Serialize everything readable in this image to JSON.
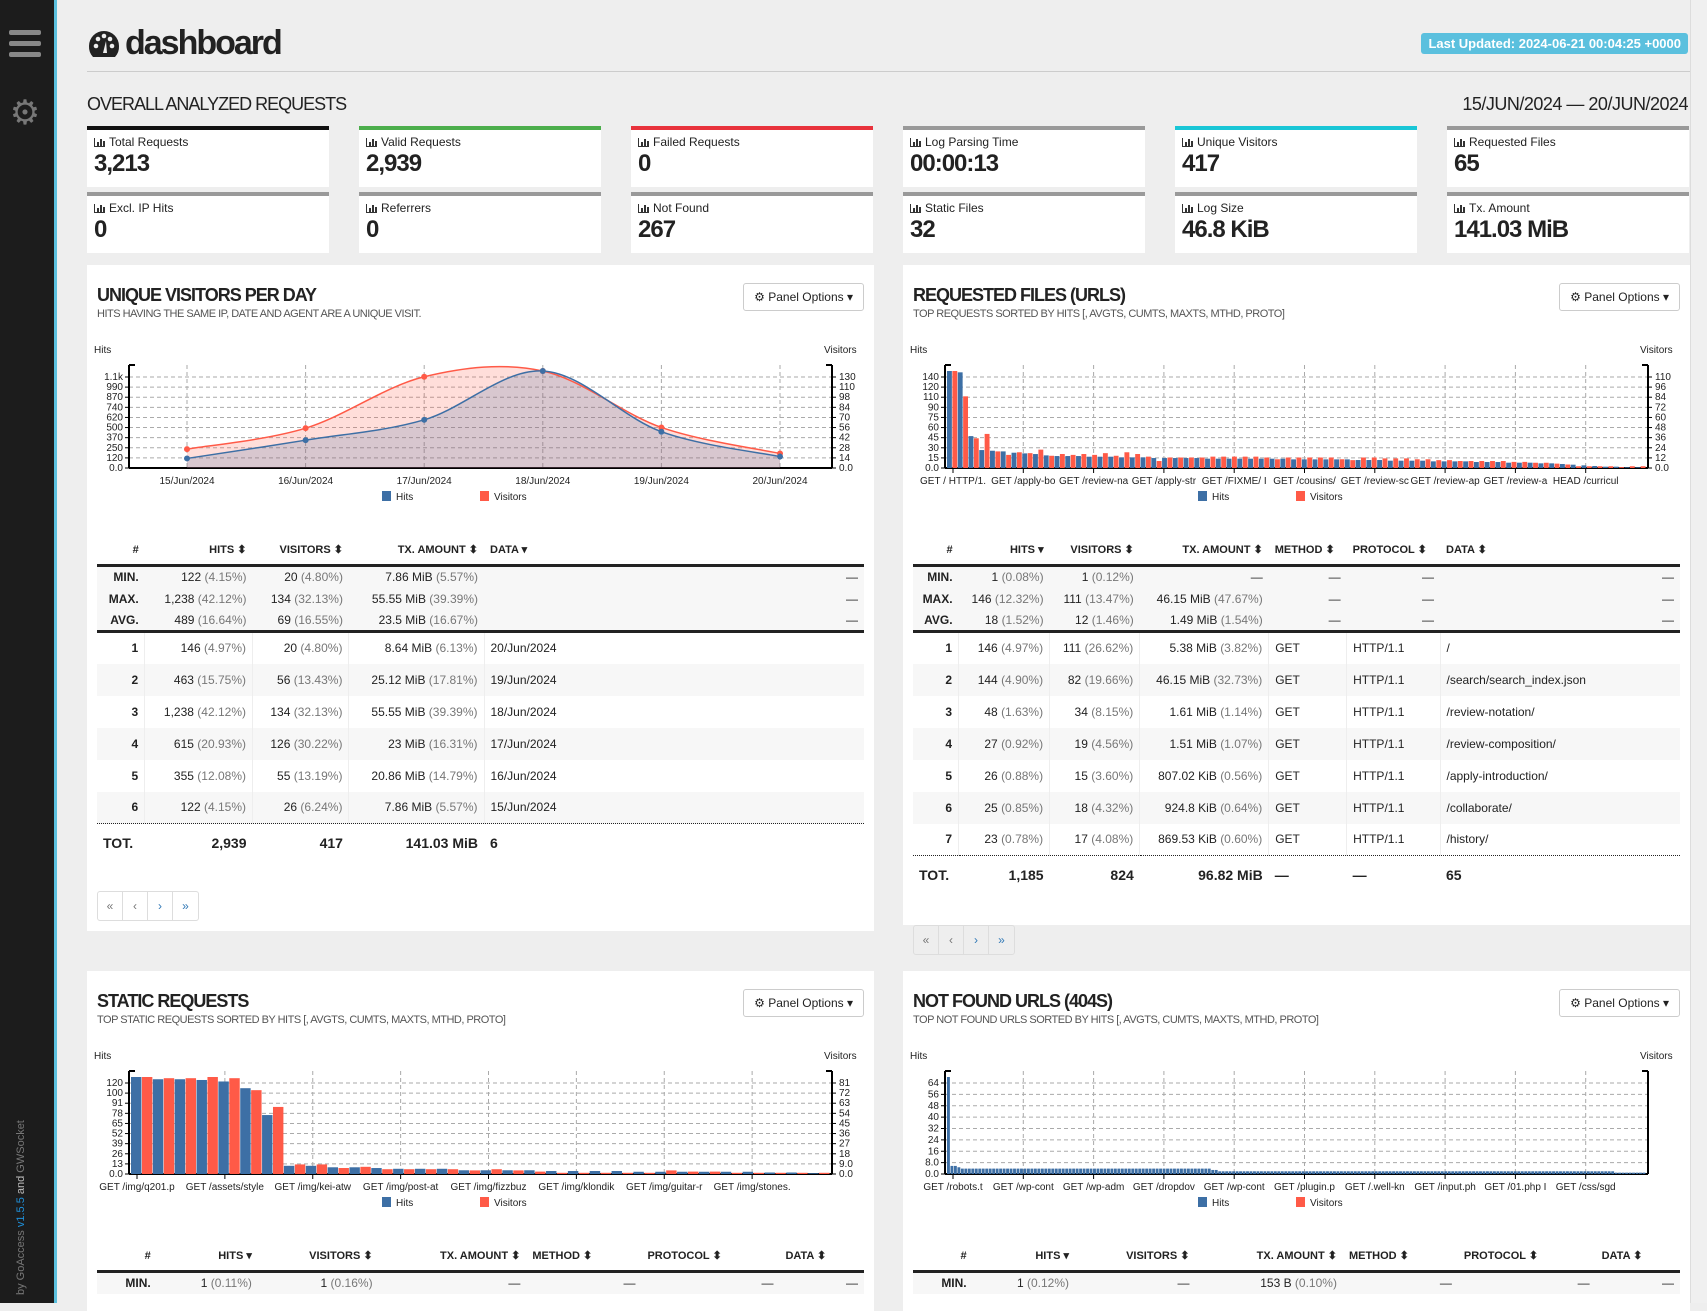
{
  "sidebar": {
    "credit_prefix": "by GoAccess ",
    "version": "v1.5.5",
    "credit_and": " and ",
    "credit_suffix": "GWSocket"
  },
  "header": {
    "title": "dashboard",
    "last_updated": "Last Updated: 2024-06-21 00:04:25 +0000"
  },
  "overall": {
    "title": "OVERALL ANALYZED REQUESTS",
    "date_range": "15/JUN/2024 — 20/JUN/2024",
    "kpis": [
      {
        "label": "Total Requests",
        "value": "3,213",
        "color": "#111111"
      },
      {
        "label": "Valid Requests",
        "value": "2,939",
        "color": "#4cae4c"
      },
      {
        "label": "Failed Requests",
        "value": "0",
        "color": "#e8323c"
      },
      {
        "label": "Log Parsing Time",
        "value": "00:00:13",
        "color": "#999999"
      },
      {
        "label": "Unique Visitors",
        "value": "417",
        "color": "#19c6d6"
      },
      {
        "label": "Requested Files",
        "value": "65",
        "color": "#999999"
      },
      {
        "label": "Excl. IP Hits",
        "value": "0",
        "color": "#999999"
      },
      {
        "label": "Referrers",
        "value": "0",
        "color": "#999999"
      },
      {
        "label": "Not Found",
        "value": "267",
        "color": "#999999"
      },
      {
        "label": "Static Files",
        "value": "32",
        "color": "#999999"
      },
      {
        "label": "Log Size",
        "value": "46.8 KiB",
        "color": "#999999"
      },
      {
        "label": "Tx. Amount",
        "value": "141.03 MiB",
        "color": "#999999"
      }
    ]
  },
  "colors": {
    "hits": "#3d6fa5",
    "visitors": "#ff5a47",
    "accent": "#5bc0de"
  },
  "panel_options_label": "Panel Options",
  "legend": {
    "hits": "Hits",
    "visitors": "Visitors"
  },
  "pager": [
    "«",
    "‹",
    "›",
    "»"
  ],
  "visitors_panel": {
    "title": "UNIQUE VISITORS PER DAY",
    "subtitle": "HITS HAVING THE SAME IP, DATE AND AGENT ARE A UNIQUE VISIT.",
    "columns": [
      "#",
      "HITS ⬍",
      "VISITORS ⬍",
      "TX. AMOUNT ⬍",
      "DATA ▾"
    ],
    "stats": [
      {
        "label": "MIN.",
        "hits": "122",
        "hits_pct": "(4.15%)",
        "visitors": "20",
        "visitors_pct": "(4.80%)",
        "tx": "7.86 MiB",
        "tx_pct": "(5.57%)",
        "data": "—"
      },
      {
        "label": "MAX.",
        "hits": "1,238",
        "hits_pct": "(42.12%)",
        "visitors": "134",
        "visitors_pct": "(32.13%)",
        "tx": "55.55 MiB",
        "tx_pct": "(39.39%)",
        "data": "—"
      },
      {
        "label": "AVG.",
        "hits": "489",
        "hits_pct": "(16.64%)",
        "visitors": "69",
        "visitors_pct": "(16.55%)",
        "tx": "23.5 MiB",
        "tx_pct": "(16.67%)",
        "data": "—"
      }
    ],
    "rows": [
      {
        "n": "1",
        "hits": "146",
        "hits_pct": "(4.97%)",
        "visitors": "20",
        "visitors_pct": "(4.80%)",
        "tx": "8.64 MiB",
        "tx_pct": "(6.13%)",
        "data": "20/Jun/2024"
      },
      {
        "n": "2",
        "hits": "463",
        "hits_pct": "(15.75%)",
        "visitors": "56",
        "visitors_pct": "(13.43%)",
        "tx": "25.12 MiB",
        "tx_pct": "(17.81%)",
        "data": "19/Jun/2024"
      },
      {
        "n": "3",
        "hits": "1,238",
        "hits_pct": "(42.12%)",
        "visitors": "134",
        "visitors_pct": "(32.13%)",
        "tx": "55.55 MiB",
        "tx_pct": "(39.39%)",
        "data": "18/Jun/2024"
      },
      {
        "n": "4",
        "hits": "615",
        "hits_pct": "(20.93%)",
        "visitors": "126",
        "visitors_pct": "(30.22%)",
        "tx": "23 MiB",
        "tx_pct": "(16.31%)",
        "data": "17/Jun/2024"
      },
      {
        "n": "5",
        "hits": "355",
        "hits_pct": "(12.08%)",
        "visitors": "55",
        "visitors_pct": "(13.19%)",
        "tx": "20.86 MiB",
        "tx_pct": "(14.79%)",
        "data": "16/Jun/2024"
      },
      {
        "n": "6",
        "hits": "122",
        "hits_pct": "(4.15%)",
        "visitors": "26",
        "visitors_pct": "(6.24%)",
        "tx": "7.86 MiB",
        "tx_pct": "(5.57%)",
        "data": "15/Jun/2024"
      }
    ],
    "total": {
      "label": "TOT.",
      "hits": "2,939",
      "visitors": "417",
      "tx": "141.03 MiB",
      "data": "6"
    }
  },
  "files_panel": {
    "title": "REQUESTED FILES (URLS)",
    "subtitle": "TOP REQUESTS SORTED BY HITS [, AVGTS, CUMTS, MAXTS, MTHD, PROTO]",
    "columns": [
      "#",
      "HITS ▾",
      "VISITORS ⬍",
      "TX. AMOUNT ⬍",
      "METHOD ⬍",
      "PROTOCOL ⬍",
      "DATA ⬍"
    ],
    "stats": [
      {
        "label": "MIN.",
        "hits": "1",
        "hits_pct": "(0.08%)",
        "visitors": "1",
        "visitors_pct": "(0.12%)",
        "tx": "—",
        "tx_pct": "",
        "method": "—",
        "proto": "—",
        "data": "—"
      },
      {
        "label": "MAX.",
        "hits": "146",
        "hits_pct": "(12.32%)",
        "visitors": "111",
        "visitors_pct": "(13.47%)",
        "tx": "46.15 MiB",
        "tx_pct": "(47.67%)",
        "method": "—",
        "proto": "—",
        "data": "—"
      },
      {
        "label": "AVG.",
        "hits": "18",
        "hits_pct": "(1.52%)",
        "visitors": "12",
        "visitors_pct": "(1.46%)",
        "tx": "1.49 MiB",
        "tx_pct": "(1.54%)",
        "method": "—",
        "proto": "—",
        "data": "—"
      }
    ],
    "rows": [
      {
        "n": "1",
        "hits": "146",
        "hits_pct": "(4.97%)",
        "visitors": "111",
        "visitors_pct": "(26.62%)",
        "tx": "5.38 MiB",
        "tx_pct": "(3.82%)",
        "method": "GET",
        "proto": "HTTP/1.1",
        "data": "/"
      },
      {
        "n": "2",
        "hits": "144",
        "hits_pct": "(4.90%)",
        "visitors": "82",
        "visitors_pct": "(19.66%)",
        "tx": "46.15 MiB",
        "tx_pct": "(32.73%)",
        "method": "GET",
        "proto": "HTTP/1.1",
        "data": "/search/search_index.json"
      },
      {
        "n": "3",
        "hits": "48",
        "hits_pct": "(1.63%)",
        "visitors": "34",
        "visitors_pct": "(8.15%)",
        "tx": "1.61 MiB",
        "tx_pct": "(1.14%)",
        "method": "GET",
        "proto": "HTTP/1.1",
        "data": "/review-notation/"
      },
      {
        "n": "4",
        "hits": "27",
        "hits_pct": "(0.92%)",
        "visitors": "19",
        "visitors_pct": "(4.56%)",
        "tx": "1.51 MiB",
        "tx_pct": "(1.07%)",
        "method": "GET",
        "proto": "HTTP/1.1",
        "data": "/review-composition/"
      },
      {
        "n": "5",
        "hits": "26",
        "hits_pct": "(0.88%)",
        "visitors": "15",
        "visitors_pct": "(3.60%)",
        "tx": "807.02 KiB",
        "tx_pct": "(0.56%)",
        "method": "GET",
        "proto": "HTTP/1.1",
        "data": "/apply-introduction/"
      },
      {
        "n": "6",
        "hits": "25",
        "hits_pct": "(0.85%)",
        "visitors": "18",
        "visitors_pct": "(4.32%)",
        "tx": "924.8 KiB",
        "tx_pct": "(0.64%)",
        "method": "GET",
        "proto": "HTTP/1.1",
        "data": "/collaborate/"
      },
      {
        "n": "7",
        "hits": "23",
        "hits_pct": "(0.78%)",
        "visitors": "17",
        "visitors_pct": "(4.08%)",
        "tx": "869.53 KiB",
        "tx_pct": "(0.60%)",
        "method": "GET",
        "proto": "HTTP/1.1",
        "data": "/history/"
      }
    ],
    "total": {
      "label": "TOT.",
      "hits": "1,185",
      "visitors": "824",
      "tx": "96.82 MiB",
      "method": "—",
      "proto": "—",
      "data": "65"
    }
  },
  "static_panel": {
    "title": "STATIC REQUESTS",
    "subtitle": "TOP STATIC REQUESTS SORTED BY HITS [, AVGTS, CUMTS, MAXTS, MTHD, PROTO]",
    "columns": [
      "#",
      "HITS ▾",
      "VISITORS ⬍",
      "TX. AMOUNT ⬍",
      "METHOD ⬍",
      "PROTOCOL ⬍",
      "DATA ⬍"
    ],
    "stats": [
      {
        "label": "MIN.",
        "hits": "1",
        "hits_pct": "(0.11%)",
        "visitors": "1",
        "visitors_pct": "(0.16%)",
        "tx": "—",
        "tx_pct": "",
        "method": "—",
        "proto": "—",
        "data": "—"
      }
    ]
  },
  "notfound_panel": {
    "title": "NOT FOUND URLS (404S)",
    "subtitle": "TOP NOT FOUND URLS SORTED BY HITS [, AVGTS, CUMTS, MAXTS, MTHD, PROTO]",
    "columns": [
      "#",
      "HITS ▾",
      "VISITORS ⬍",
      "TX. AMOUNT ⬍",
      "METHOD ⬍",
      "PROTOCOL ⬍",
      "DATA ⬍"
    ],
    "stats": [
      {
        "label": "MIN.",
        "hits": "1",
        "hits_pct": "(0.12%)",
        "visitors": "—",
        "visitors_pct": "",
        "tx": "153 B",
        "tx_pct": "(0.10%)",
        "method": "—",
        "proto": "—",
        "data": "—"
      }
    ]
  },
  "chart_data": [
    {
      "type": "area",
      "title": "Unique Visitors Per Day",
      "x": [
        "15/Jun/2024",
        "16/Jun/2024",
        "17/Jun/2024",
        "18/Jun/2024",
        "19/Jun/2024",
        "20/Jun/2024"
      ],
      "series": [
        {
          "name": "Hits",
          "axis": "left",
          "values": [
            122,
            355,
            615,
            1238,
            463,
            146
          ]
        },
        {
          "name": "Visitors",
          "axis": "right",
          "values": [
            26,
            55,
            126,
            134,
            56,
            20
          ]
        }
      ],
      "ylabel": "Hits",
      "y2label": "Visitors",
      "yticks": [
        "0.0",
        "120",
        "250",
        "370",
        "500",
        "620",
        "740",
        "870",
        "990",
        "1.1k"
      ],
      "y2ticks": [
        "0.0",
        "14",
        "28",
        "42",
        "56",
        "70",
        "84",
        "98",
        "110",
        "130"
      ],
      "ylim": [
        0,
        1238
      ],
      "y2lim": [
        0,
        134
      ],
      "grid": true,
      "legend": "bottom"
    },
    {
      "type": "bar",
      "title": "Requested Files (URLs)",
      "xticklabels": [
        "GET / HTTP/1.",
        "GET /apply-bo",
        "GET /review-na",
        "GET /apply-str",
        "GET /FIXME/ I",
        "GET /cousins/",
        "GET /review-sc",
        "GET /review-ap",
        "GET /review-a",
        "HEAD /curricul"
      ],
      "series": [
        {
          "name": "Hits",
          "axis": "left",
          "values": [
            146,
            144,
            48,
            27,
            26,
            25,
            23,
            22,
            21,
            19,
            18,
            18,
            18,
            17,
            17,
            17,
            16,
            16,
            16,
            15,
            15,
            15,
            15,
            15,
            14,
            14,
            14,
            14,
            14,
            14,
            14,
            14,
            13,
            13,
            13,
            13,
            13,
            13,
            12,
            12,
            12,
            11,
            11,
            11,
            11,
            10,
            10,
            10,
            10,
            9,
            9,
            9,
            8,
            8,
            8,
            7,
            7,
            6,
            5,
            4,
            3,
            2,
            2,
            1,
            1
          ]
        },
        {
          "name": "Visitors",
          "axis": "right",
          "values": [
            111,
            82,
            34,
            39,
            19,
            15,
            18,
            17,
            21,
            14,
            16,
            15,
            16,
            15,
            17,
            14,
            18,
            16,
            13,
            8,
            12,
            12,
            12,
            12,
            13,
            13,
            13,
            13,
            13,
            12,
            10,
            12,
            12,
            12,
            12,
            12,
            10,
            9,
            12,
            12,
            11,
            11,
            11,
            10,
            10,
            9,
            9,
            8,
            8,
            8,
            8,
            8,
            7,
            7,
            6,
            6,
            5,
            4,
            2,
            2,
            2,
            2,
            1,
            2,
            2
          ]
        }
      ],
      "ylabel": "Hits",
      "y2label": "Visitors",
      "yticks": [
        "0.0",
        "15",
        "30",
        "45",
        "60",
        "75",
        "90",
        "110",
        "120",
        "140"
      ],
      "y2ticks": [
        "0.0",
        "12",
        "24",
        "36",
        "48",
        "60",
        "72",
        "84",
        "96",
        "110"
      ],
      "ylim": [
        0,
        146
      ],
      "y2lim": [
        0,
        111
      ],
      "grid": true,
      "legend": "bottom"
    },
    {
      "type": "bar",
      "title": "Static Requests",
      "xticklabels": [
        "GET /img/q201.p",
        "GET /assets/style",
        "GET /img/kei-atw",
        "GET /img/post-at",
        "GET /img/fizzbuz",
        "GET /img/klondik",
        "GET /img/guitar-r",
        "GET /img/stones."
      ],
      "series": [
        {
          "name": "Hits",
          "axis": "left",
          "values": [
            130,
            127,
            127,
            126,
            124,
            115,
            79,
            11,
            11,
            9,
            9,
            8,
            7,
            7,
            7,
            5,
            5,
            5,
            5,
            4,
            4,
            4,
            4,
            3,
            3,
            3,
            3,
            3,
            3,
            2,
            2,
            1
          ]
        },
        {
          "name": "Visitors",
          "axis": "right",
          "values": [
            81,
            80,
            80,
            81,
            80,
            70,
            56,
            8,
            8,
            5,
            6,
            4,
            4,
            4,
            4,
            3,
            4,
            3,
            2,
            1,
            1,
            1,
            1,
            1,
            3,
            2,
            2,
            1,
            1,
            1,
            1,
            1
          ]
        }
      ],
      "ylabel": "Hits",
      "y2label": "Visitors",
      "yticks": [
        "0.0",
        "13",
        "26",
        "39",
        "52",
        "65",
        "78",
        "91",
        "100",
        "120"
      ],
      "y2ticks": [
        "0.0",
        "9.0",
        "18",
        "27",
        "36",
        "45",
        "54",
        "63",
        "72",
        "81"
      ],
      "ylim": [
        0,
        130
      ],
      "y2lim": [
        0,
        81
      ],
      "grid": true,
      "legend": "bottom"
    },
    {
      "type": "bar",
      "title": "Not Found URLs (404s)",
      "xticklabels": [
        "GET /robots.t",
        "GET /wp-cont",
        "GET /wp-adm",
        "GET /dropdov",
        "GET /wp-cont",
        "GET /plugin.p",
        "GET /.well-kn",
        "GET /input.ph",
        "GET /01.php I",
        "GET /css/sgd"
      ],
      "series": [
        {
          "name": "Hits",
          "axis": "left",
          "values": [
            72,
            6,
            6,
            5,
            4,
            4,
            4,
            4,
            4,
            4,
            4,
            4,
            4,
            4,
            4,
            4,
            4,
            4,
            4,
            4,
            4,
            4,
            4,
            4,
            4,
            4,
            4,
            4,
            4,
            4,
            4,
            4,
            4,
            4,
            4,
            4,
            4,
            4,
            4,
            4,
            4,
            4,
            4,
            4,
            4,
            4,
            4,
            4,
            4,
            4,
            4,
            4,
            4,
            4,
            4,
            4,
            4,
            4,
            4,
            4,
            4,
            4,
            4,
            4,
            4,
            4,
            4,
            4,
            4,
            4,
            4,
            4,
            4,
            4,
            4,
            4,
            3,
            3,
            2,
            2,
            2,
            2,
            2,
            2,
            2,
            2,
            2,
            2,
            2,
            2,
            2,
            2,
            2,
            2,
            2,
            2,
            2,
            2,
            2,
            2,
            2,
            2,
            2,
            2,
            2,
            2,
            2,
            2,
            2,
            2,
            2,
            2,
            2,
            2,
            2,
            2,
            2,
            2,
            2,
            2,
            2,
            2,
            2,
            2,
            2,
            2,
            2,
            2,
            2,
            2,
            2,
            2,
            2,
            2,
            2,
            2,
            2,
            2,
            2,
            2,
            2,
            2,
            2,
            2,
            2,
            2,
            2,
            2,
            2,
            2,
            2,
            2,
            2,
            2,
            2,
            2,
            2,
            2,
            2,
            2,
            2,
            2,
            2,
            2,
            2,
            2,
            2,
            2,
            2,
            2,
            2,
            2,
            2,
            2,
            2,
            2,
            2,
            2,
            2,
            2,
            2,
            2,
            2,
            2,
            2,
            2,
            2,
            2,
            2,
            2,
            2,
            2,
            1,
            1,
            1,
            1,
            1,
            1,
            1,
            1,
            1
          ]
        },
        {
          "name": "Visitors",
          "axis": "right",
          "values": []
        }
      ],
      "ylabel": "Hits",
      "y2label": "Visitors",
      "yticks": [
        "0.0",
        "8.0",
        "16",
        "24",
        "32",
        "40",
        "48",
        "56",
        "64"
      ],
      "y2ticks": [],
      "ylim": [
        0,
        72
      ],
      "grid": true,
      "legend": "bottom"
    }
  ]
}
